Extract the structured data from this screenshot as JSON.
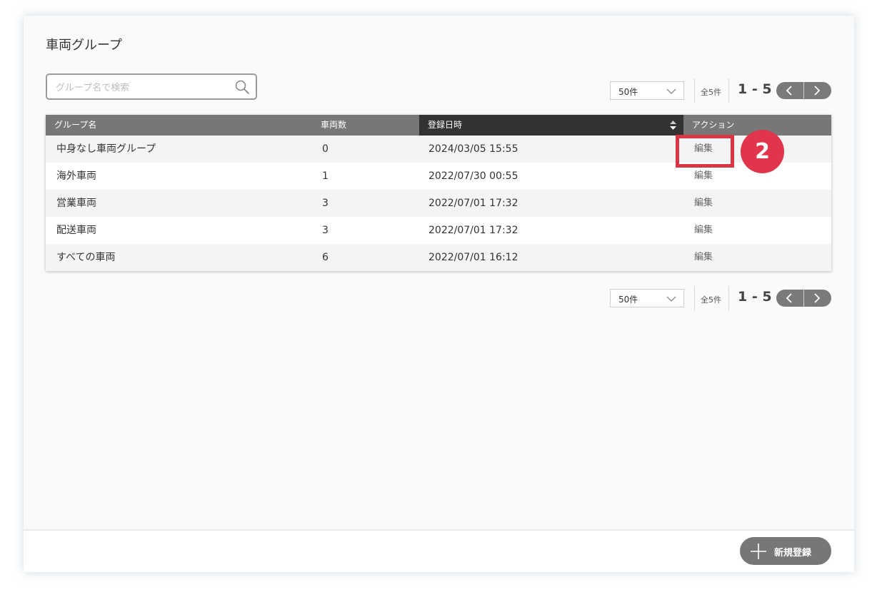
{
  "page": {
    "title": "車両グループ"
  },
  "search": {
    "placeholder": "グループ名で検索",
    "value": ""
  },
  "pagination_top": {
    "per_page": "50件",
    "total": "全5件",
    "range": "1 - 5"
  },
  "pagination_bottom": {
    "per_page": "50件",
    "total": "全5件",
    "range": "1 - 5"
  },
  "table": {
    "headers": {
      "group_name": "グループ名",
      "vehicle_count": "車両数",
      "registered_at": "登録日時",
      "action": "アクション"
    },
    "rows": [
      {
        "group_name": "中身なし車両グループ",
        "vehicle_count": "0",
        "registered_at": "2024/03/05 15:55",
        "action": "編集"
      },
      {
        "group_name": "海外車両",
        "vehicle_count": "1",
        "registered_at": "2022/07/30 00:55",
        "action": "編集"
      },
      {
        "group_name": "営業車両",
        "vehicle_count": "3",
        "registered_at": "2022/07/01 17:32",
        "action": "編集"
      },
      {
        "group_name": "配送車両",
        "vehicle_count": "3",
        "registered_at": "2022/07/01 17:32",
        "action": "編集"
      },
      {
        "group_name": "すべての車両",
        "vehicle_count": "6",
        "registered_at": "2022/07/01 16:12",
        "action": "編集"
      }
    ]
  },
  "annotation": {
    "step_number": "2",
    "color": "#e0354d"
  },
  "footer": {
    "new_button_label": "新規登録"
  },
  "icons": {
    "search": "search-icon",
    "select_chevron": "chevron-down-icon",
    "prev": "chevron-left-icon",
    "next": "chevron-right-icon",
    "sort": "sort-icon",
    "plus": "plus-icon"
  },
  "colors": {
    "header_bg": "#777777",
    "sorted_header_bg": "#333333",
    "button_bg": "#777777"
  }
}
